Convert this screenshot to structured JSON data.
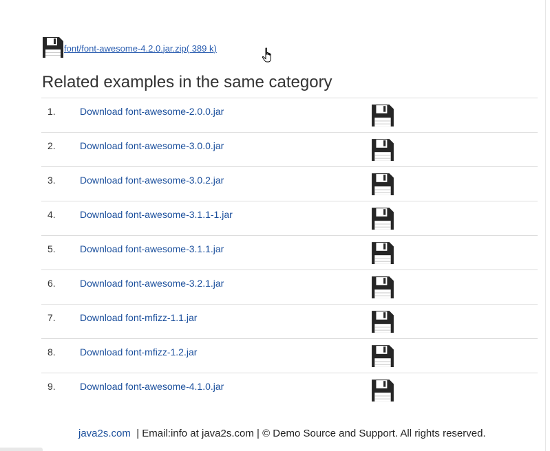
{
  "download": {
    "link_text": "font/font-awesome-4.2.0.jar.zip( 389 k)",
    "icon": "floppy-disk-icon"
  },
  "related": {
    "title": "Related examples in the same category",
    "items": [
      {
        "num": "1.",
        "label": "Download font-awesome-2.0.0.jar"
      },
      {
        "num": "2.",
        "label": "Download font-awesome-3.0.0.jar"
      },
      {
        "num": "3.",
        "label": "Download font-awesome-3.0.2.jar"
      },
      {
        "num": "4.",
        "label": "Download font-awesome-3.1.1-1.jar"
      },
      {
        "num": "5.",
        "label": "Download font-awesome-3.1.1.jar"
      },
      {
        "num": "6.",
        "label": "Download font-awesome-3.2.1.jar"
      },
      {
        "num": "7.",
        "label": "Download font-mfizz-1.1.jar"
      },
      {
        "num": "8.",
        "label": "Download font-mfizz-1.2.jar"
      },
      {
        "num": "9.",
        "label": "Download font-awesome-4.1.0.jar"
      }
    ]
  },
  "footer": {
    "site": "java2s.com",
    "text": "| Email:info at java2s.com | © Demo Source and Support. All rights reserved."
  },
  "colors": {
    "link": "#1b4f9c",
    "text": "#333333",
    "divider": "#dddddd"
  }
}
